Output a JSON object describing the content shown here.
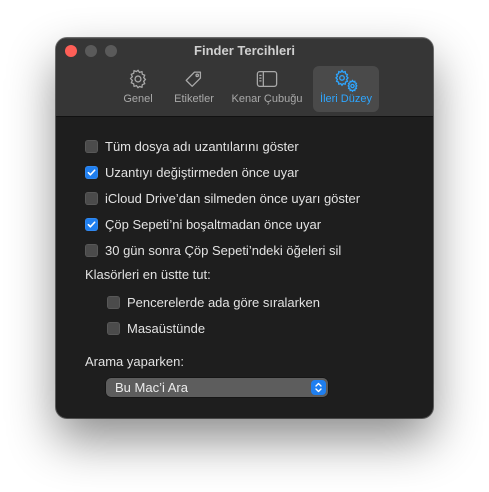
{
  "window": {
    "title": "Finder Tercihleri"
  },
  "tabs": [
    {
      "label": "Genel",
      "icon": "gear-icon",
      "active": false
    },
    {
      "label": "Etiketler",
      "icon": "tag-icon",
      "active": false
    },
    {
      "label": "Kenar Çubuğu",
      "icon": "sidebar-icon",
      "active": false
    },
    {
      "label": "İleri Düzey",
      "icon": "advanced-gears-icon",
      "active": true
    }
  ],
  "options": [
    {
      "label": "Tüm dosya adı uzantılarını göster",
      "checked": false
    },
    {
      "label": "Uzantıyı değiştirmeden önce uyar",
      "checked": true
    },
    {
      "label": "iCloud Drive’dan silmeden önce uyarı göster",
      "checked": false
    },
    {
      "label": "Çöp Sepeti’ni boşaltmadan önce uyar",
      "checked": true
    },
    {
      "label": "30 gün sonra Çöp Sepeti’ndeki öğeleri sil",
      "checked": false
    }
  ],
  "folders_on_top": {
    "heading": "Klasörleri en üstte tut:",
    "options": [
      {
        "label": "Pencerelerde ada göre sıralarken",
        "checked": false
      },
      {
        "label": "Masaüstünde",
        "checked": false
      }
    ]
  },
  "search": {
    "heading": "Arama yaparken:",
    "selected": "Bu Mac’i Ara"
  },
  "colors": {
    "accent": "#1f7ff0",
    "active_tab_label": "#2ea6ff",
    "close_button": "#fe5f57"
  }
}
